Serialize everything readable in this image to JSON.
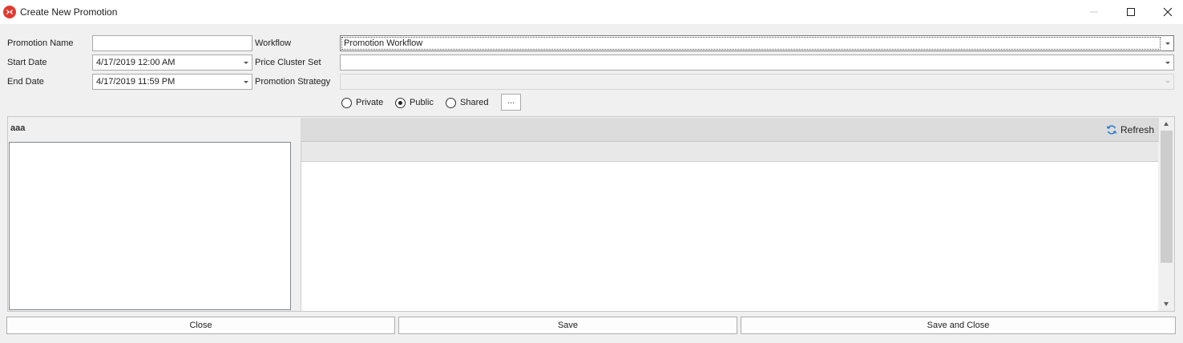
{
  "window": {
    "title": "Create New Promotion",
    "icon": "close-circle-icon",
    "controls": [
      "minimize-icon",
      "maximize-icon",
      "close-icon"
    ]
  },
  "form": {
    "promotion_name": {
      "label": "Promotion Name",
      "value": ""
    },
    "start_date": {
      "label": "Start Date",
      "value": "4/17/2019 12:00 AM"
    },
    "end_date": {
      "label": "End Date",
      "value": "4/17/2019 11:59 PM"
    },
    "workflow": {
      "label": "Workflow",
      "value": "Promotion Workflow"
    },
    "price_cluster_set": {
      "label": "Price Cluster Set",
      "value": ""
    },
    "promotion_strategy": {
      "label": "Promotion Strategy",
      "value": ""
    },
    "visibility": {
      "options": [
        {
          "label": "Private",
          "selected": false
        },
        {
          "label": "Public",
          "selected": true
        },
        {
          "label": "Shared",
          "selected": false
        }
      ],
      "more_label": "..."
    }
  },
  "left_panel": {
    "title": "aaa"
  },
  "grid": {
    "refresh_label": "Refresh"
  },
  "footer": {
    "close_label": "Close",
    "save_label": "Save",
    "save_close_label": "Save and Close"
  },
  "colors": {
    "title_icon": "#e03a2f",
    "accent": "#2a7bd3"
  }
}
